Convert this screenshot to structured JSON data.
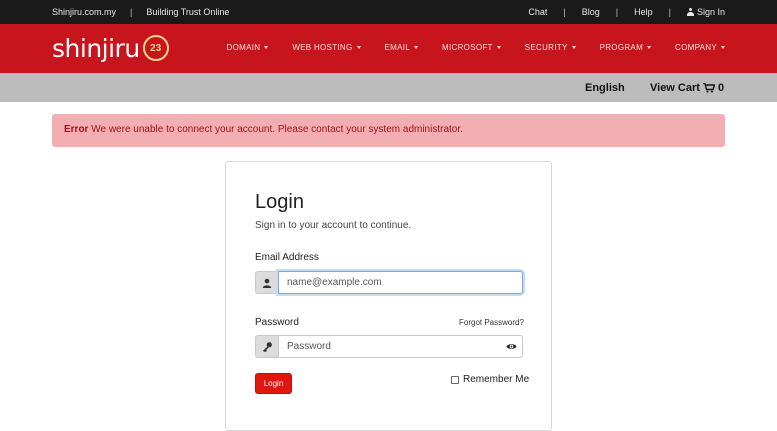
{
  "topbar": {
    "site": "Shinjiru.com.my",
    "tagline": "Building Trust Online",
    "links": [
      "Chat",
      "Blog",
      "Help",
      "Sign In"
    ]
  },
  "navbar": {
    "logo_text": "shinjiru",
    "logo_badge": "23",
    "menu": [
      "DOMAIN",
      "WEB HOSTING",
      "EMAIL",
      "MICROSOFT",
      "SECURITY",
      "PROGRAM",
      "COMPANY"
    ]
  },
  "subbar": {
    "language": "English",
    "cart_label": "View Cart",
    "cart_count": "0"
  },
  "alert": {
    "prefix": "Error",
    "message": "We were unable to connect your account. Please contact your system administrator."
  },
  "login": {
    "title": "Login",
    "subtitle": "Sign in to your account to continue.",
    "email_label": "Email Address",
    "email_placeholder": "name@example.com",
    "password_label": "Password",
    "password_placeholder": "Password",
    "forgot_label": "Forgot Password?",
    "button_label": "Login",
    "remember_label": "Remember Me"
  },
  "colors": {
    "brand_red": "#c8141c",
    "alert_bg": "#f2aeb2",
    "button_red": "#e3160e"
  }
}
